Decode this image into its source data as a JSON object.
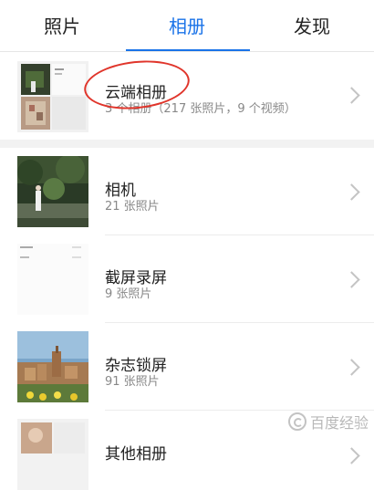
{
  "tabs": [
    {
      "label": "照片"
    },
    {
      "label": "相册"
    },
    {
      "label": "发现"
    }
  ],
  "albums": [
    {
      "title": "云端相册",
      "subtitle": "3 个相册（217 张照片，9 个视频）"
    },
    {
      "title": "相机",
      "subtitle": "21 张照片"
    },
    {
      "title": "截屏录屏",
      "subtitle": "9 张照片"
    },
    {
      "title": "杂志锁屏",
      "subtitle": "91 张照片"
    },
    {
      "title": "其他相册",
      "subtitle": ""
    }
  ],
  "watermark": {
    "text": "百度经验"
  },
  "colors": {
    "accent": "#1a73e8",
    "annotation": "#e0352b"
  }
}
